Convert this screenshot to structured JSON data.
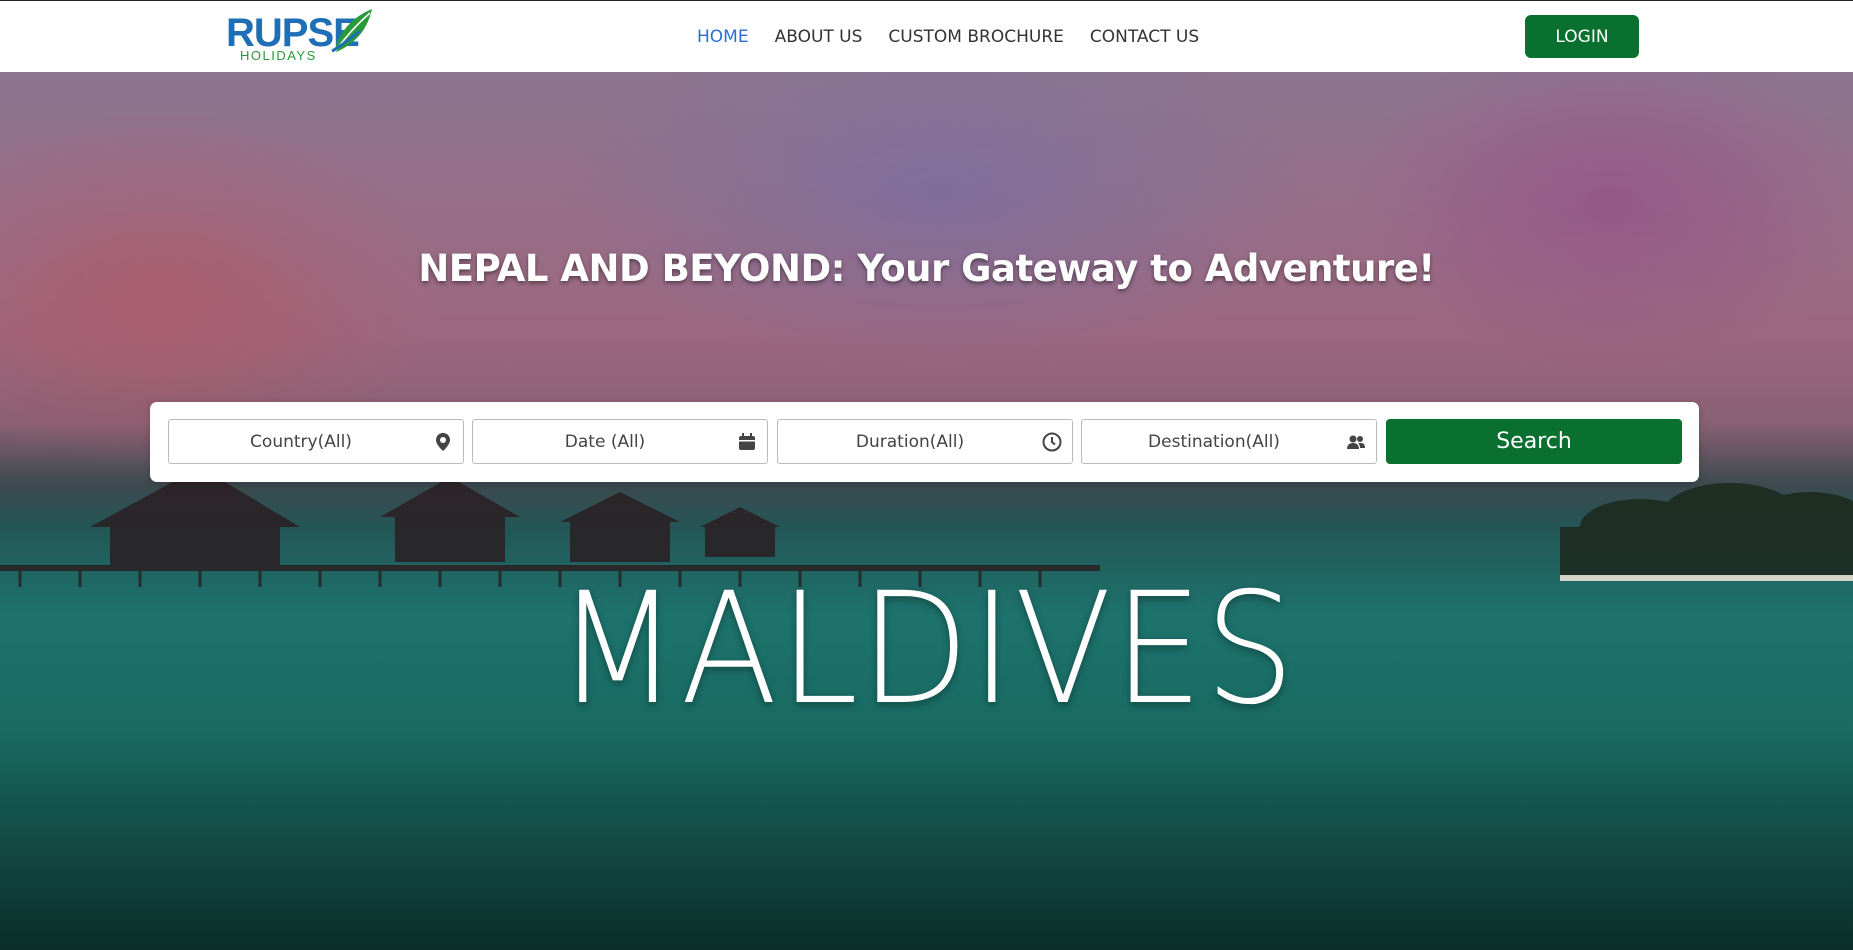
{
  "brand": {
    "name": "RUPSE",
    "sub": "HOLIDAYS",
    "primary_color": "#1f6fb7",
    "accent_color": "#2a9a3a"
  },
  "nav": {
    "items": [
      {
        "label": "HOME",
        "active": true
      },
      {
        "label": "ABOUT US",
        "active": false
      },
      {
        "label": "CUSTOM BROCHURE",
        "active": false
      },
      {
        "label": "CONTACT US",
        "active": false
      }
    ],
    "active_color": "#2a6fd1",
    "login_label": "LOGIN",
    "button_color": "#0a7030"
  },
  "hero": {
    "tagline": "NEPAL AND BEYOND: Your Gateway to Adventure!",
    "destination": "MALDIVES"
  },
  "search": {
    "fields": [
      {
        "label": "Country(All)",
        "icon": "map-pin-icon"
      },
      {
        "label": "Date (All)",
        "icon": "calendar-icon"
      },
      {
        "label": "Duration(All)",
        "icon": "clock-icon"
      },
      {
        "label": "Destination(All)",
        "icon": "people-icon"
      }
    ],
    "button_label": "Search"
  }
}
